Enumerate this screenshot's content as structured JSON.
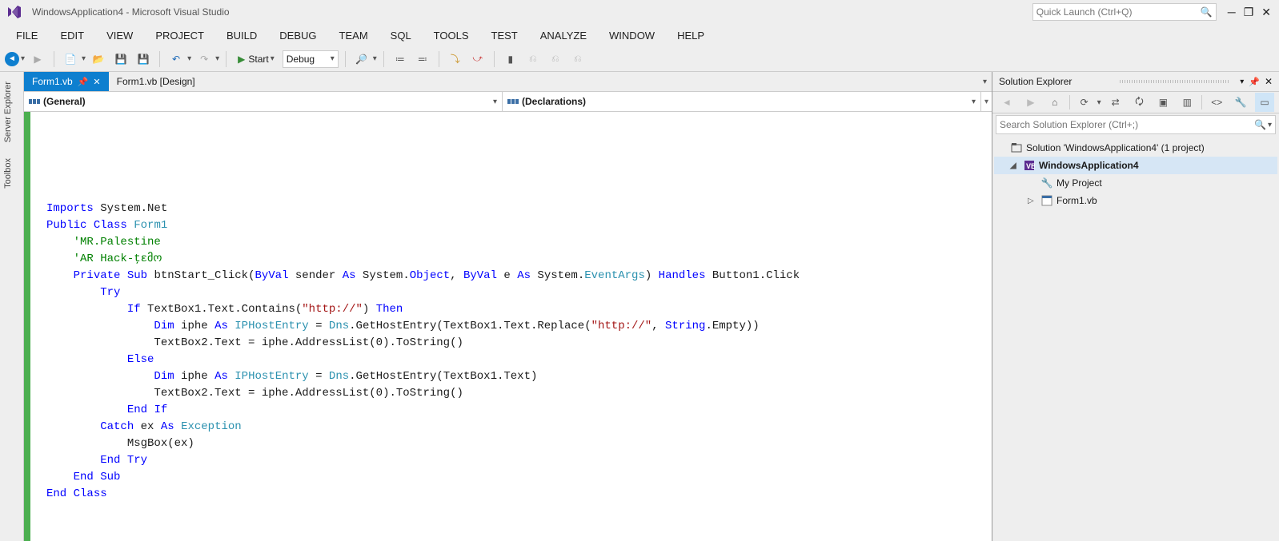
{
  "window": {
    "title": "WindowsApplication4 - Microsoft Visual Studio",
    "quick_launch_placeholder": "Quick Launch (Ctrl+Q)"
  },
  "menu": [
    "FILE",
    "EDIT",
    "VIEW",
    "PROJECT",
    "BUILD",
    "DEBUG",
    "TEAM",
    "SQL",
    "TOOLS",
    "TEST",
    "ANALYZE",
    "WINDOW",
    "HELP"
  ],
  "toolbar": {
    "start_label": "Start",
    "config_label": "Debug"
  },
  "side_tabs": [
    "Server Explorer",
    "Toolbox"
  ],
  "doc_tabs": [
    {
      "label": "Form1.vb",
      "active": true
    },
    {
      "label": "Form1.vb [Design]",
      "active": false
    }
  ],
  "nav": {
    "left": "(General)",
    "right": "(Declarations)"
  },
  "code": {
    "lines": [
      [
        [
          "kw",
          "Imports"
        ],
        [
          "",
          " System.Net"
        ]
      ],
      [
        [
          "kw",
          "Public"
        ],
        [
          "",
          " "
        ],
        [
          "kw",
          "Class"
        ],
        [
          "",
          " "
        ],
        [
          "type",
          "Form1"
        ]
      ],
      [
        [
          "",
          "    "
        ],
        [
          "cmt",
          "'MR.Palestine"
        ]
      ],
      [
        [
          "",
          "    "
        ],
        [
          "cmt",
          "'AR Hack-ţɛმო"
        ]
      ],
      [
        [
          "",
          "    "
        ],
        [
          "kw",
          "Private"
        ],
        [
          "",
          " "
        ],
        [
          "kw",
          "Sub"
        ],
        [
          "",
          " btnStart_Click("
        ],
        [
          "kw",
          "ByVal"
        ],
        [
          "",
          " sender "
        ],
        [
          "kw",
          "As"
        ],
        [
          "",
          " System."
        ],
        [
          "kw",
          "Object"
        ],
        [
          "",
          ", "
        ],
        [
          "kw",
          "ByVal"
        ],
        [
          "",
          " e "
        ],
        [
          "kw",
          "As"
        ],
        [
          "",
          " System."
        ],
        [
          "type",
          "EventArgs"
        ],
        [
          "",
          ") "
        ],
        [
          "kw",
          "Handles"
        ],
        [
          "",
          " Button1.Click"
        ]
      ],
      [
        [
          "",
          "        "
        ],
        [
          "kw",
          "Try"
        ]
      ],
      [
        [
          "",
          "            "
        ],
        [
          "kw",
          "If"
        ],
        [
          "",
          " TextBox1.Text.Contains("
        ],
        [
          "str",
          "\"http://\""
        ],
        [
          "",
          ") "
        ],
        [
          "kw",
          "Then"
        ]
      ],
      [
        [
          "",
          "                "
        ],
        [
          "kw",
          "Dim"
        ],
        [
          "",
          " iphe "
        ],
        [
          "kw",
          "As"
        ],
        [
          "",
          " "
        ],
        [
          "type",
          "IPHostEntry"
        ],
        [
          "",
          " = "
        ],
        [
          "type",
          "Dns"
        ],
        [
          "",
          ".GetHostEntry(TextBox1.Text.Replace("
        ],
        [
          "str",
          "\"http://\""
        ],
        [
          "",
          ", "
        ],
        [
          "kw",
          "String"
        ],
        [
          "",
          ".Empty))"
        ]
      ],
      [
        [
          "",
          "                TextBox2.Text = iphe.AddressList(0).ToString()"
        ]
      ],
      [
        [
          "",
          "            "
        ],
        [
          "kw",
          "Else"
        ]
      ],
      [
        [
          "",
          "                "
        ],
        [
          "kw",
          "Dim"
        ],
        [
          "",
          " iphe "
        ],
        [
          "kw",
          "As"
        ],
        [
          "",
          " "
        ],
        [
          "type",
          "IPHostEntry"
        ],
        [
          "",
          " = "
        ],
        [
          "type",
          "Dns"
        ],
        [
          "",
          ".GetHostEntry(TextBox1.Text)"
        ]
      ],
      [
        [
          "",
          "                TextBox2.Text = iphe.AddressList(0).ToString()"
        ]
      ],
      [
        [
          "",
          "            "
        ],
        [
          "kw",
          "End"
        ],
        [
          "",
          " "
        ],
        [
          "kw",
          "If"
        ]
      ],
      [
        [
          "",
          "        "
        ],
        [
          "kw",
          "Catch"
        ],
        [
          "",
          " ex "
        ],
        [
          "kw",
          "As"
        ],
        [
          "",
          " "
        ],
        [
          "type",
          "Exception"
        ]
      ],
      [
        [
          "",
          "            MsgBox(ex)"
        ]
      ],
      [
        [
          "",
          "        "
        ],
        [
          "kw",
          "End"
        ],
        [
          "",
          " "
        ],
        [
          "kw",
          "Try"
        ]
      ],
      [
        [
          "",
          "    "
        ],
        [
          "kw",
          "End"
        ],
        [
          "",
          " "
        ],
        [
          "kw",
          "Sub"
        ]
      ],
      [
        [
          "kw",
          "End"
        ],
        [
          "",
          " "
        ],
        [
          "kw",
          "Class"
        ]
      ]
    ]
  },
  "solution": {
    "panel_title": "Solution Explorer",
    "search_placeholder": "Search Solution Explorer (Ctrl+;)",
    "root": "Solution 'WindowsApplication4' (1 project)",
    "project": "WindowsApplication4",
    "my_project": "My Project",
    "form": "Form1.vb"
  }
}
